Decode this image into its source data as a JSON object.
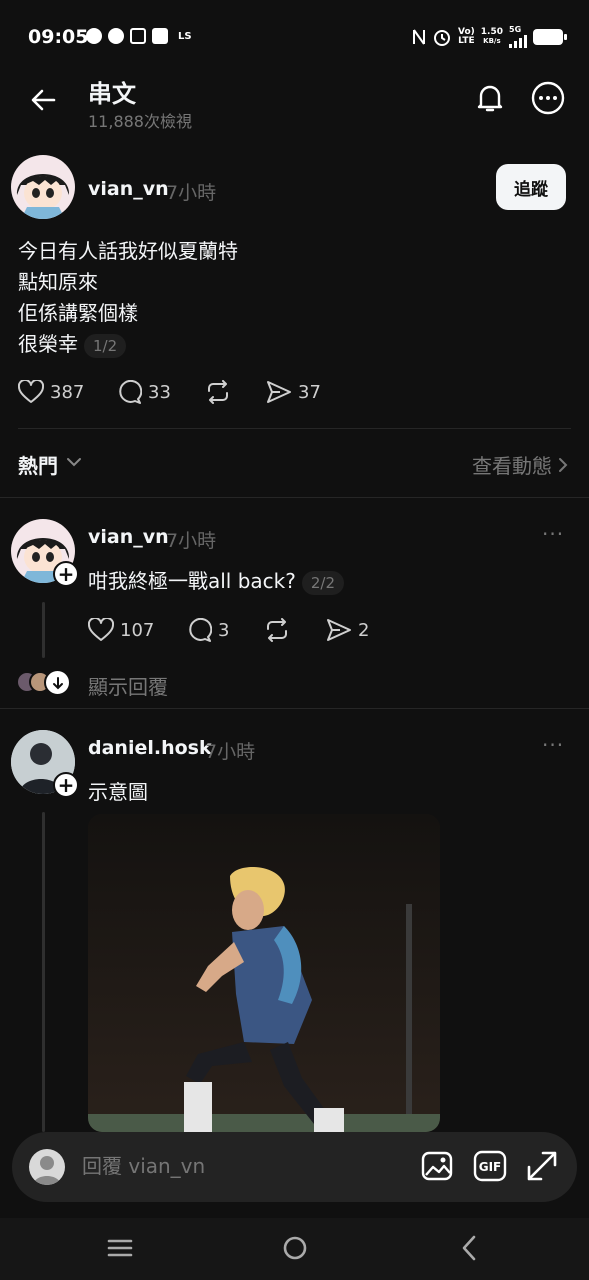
{
  "status_bar": {
    "time": "09:05",
    "left_extra": "LS",
    "speed": "1.50",
    "speed_unit": "KB/s",
    "net_top": "Vo)",
    "net_bottom": "LTE",
    "gen": "5G"
  },
  "header": {
    "title": "串文",
    "views": "11,888次檢視"
  },
  "post": {
    "username": "vian_vn",
    "time": "7小時",
    "follow_label": "追蹤",
    "lines": [
      "今日有人話我好似夏蘭特",
      "點知原來",
      "佢係講緊個樣",
      "很榮幸"
    ],
    "page_pill": "1/2",
    "likes": "387",
    "comments": "33",
    "shares": "37"
  },
  "sort": {
    "label": "熱門",
    "activity": "查看動態"
  },
  "replies": [
    {
      "username": "vian_vn",
      "time": "7小時",
      "text": "咁我終極一戰all back?",
      "page_pill": "2/2",
      "likes": "107",
      "comments": "3",
      "shares": "2",
      "show_replies": "顯示回覆"
    },
    {
      "username": "daniel.hosk",
      "time": "7小時",
      "text": "示意圖"
    }
  ],
  "reply_bar": {
    "placeholder": "回覆 vian_vn"
  },
  "icons": [
    "back-arrow-icon",
    "bell-icon",
    "more-icon",
    "heart-icon",
    "comment-icon",
    "repost-icon",
    "share-icon",
    "chevron-down-icon",
    "chevron-right-icon",
    "image-icon",
    "gif-icon",
    "expand-icon",
    "menu-icon",
    "home-circle-icon",
    "back-icon"
  ],
  "colors": {
    "background": "#101010",
    "text": "#f3f5f7",
    "muted": "#777777",
    "follow_bg": "#f3f5f7"
  }
}
